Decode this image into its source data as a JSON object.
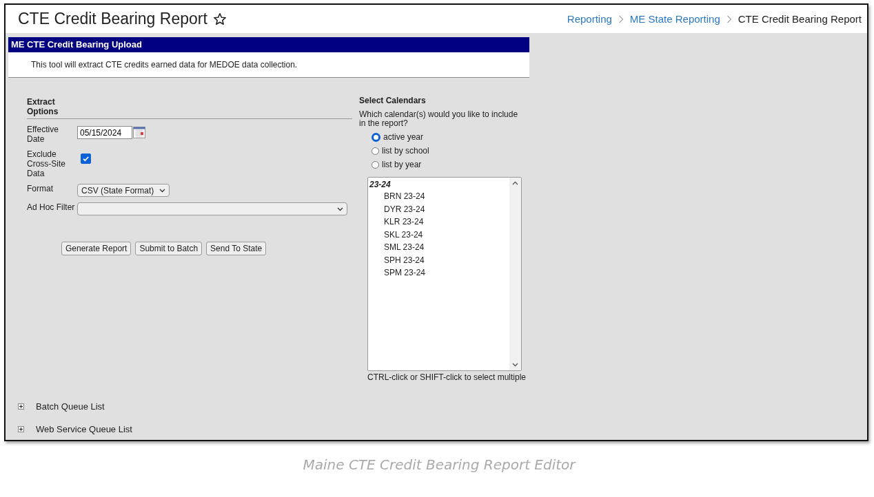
{
  "header": {
    "title": "CTE Credit Bearing Report",
    "breadcrumb": [
      {
        "label": "Reporting",
        "current": false
      },
      {
        "label": "ME State Reporting",
        "current": false
      },
      {
        "label": "CTE Credit Bearing Report",
        "current": true
      }
    ]
  },
  "panel": {
    "title": "ME CTE Credit Bearing Upload",
    "description": "This tool will extract CTE credits earned data for MEDOE data collection."
  },
  "extract_options": {
    "heading": "Extract Options",
    "fields": [
      {
        "kind": "date",
        "label": "Effective Date",
        "value": "05/15/2024"
      },
      {
        "kind": "checkbox",
        "label": "Exclude Cross-Site Data",
        "checked": true
      },
      {
        "kind": "select",
        "label": "Format",
        "value": "CSV (State Format)"
      },
      {
        "kind": "wide-select",
        "label": "Ad Hoc Filter"
      }
    ],
    "buttons": [
      "Generate Report",
      "Submit to Batch",
      "Send To State"
    ]
  },
  "calendars": {
    "heading": "Select Calendars",
    "question": "Which calendar(s) would you like to include in the report?",
    "options": [
      {
        "label": "active year",
        "selected": true
      },
      {
        "label": "list by school",
        "selected": false
      },
      {
        "label": "list by year",
        "selected": false
      }
    ],
    "list": [
      {
        "label": "23-24",
        "children": [
          {
            "label": "BRN 23-24",
            "selected": false
          },
          {
            "label": "DYR 23-24",
            "selected": false
          },
          {
            "label": "KLR 23-24",
            "selected": false
          },
          {
            "label": "SKL 23-24",
            "selected": false
          },
          {
            "label": "SML 23-24",
            "selected": false
          },
          {
            "label": "SPH 23-24",
            "selected": false
          },
          {
            "label": "SPM 23-24",
            "selected": false
          }
        ]
      }
    ],
    "hint": "CTRL-click or SHIFT-click to select multiple"
  },
  "sections": [
    {
      "label": "Batch Queue List",
      "expanded": false
    },
    {
      "label": "Web Service Queue List",
      "expanded": false
    }
  ],
  "caption": "Maine CTE Credit Bearing Report Editor"
}
